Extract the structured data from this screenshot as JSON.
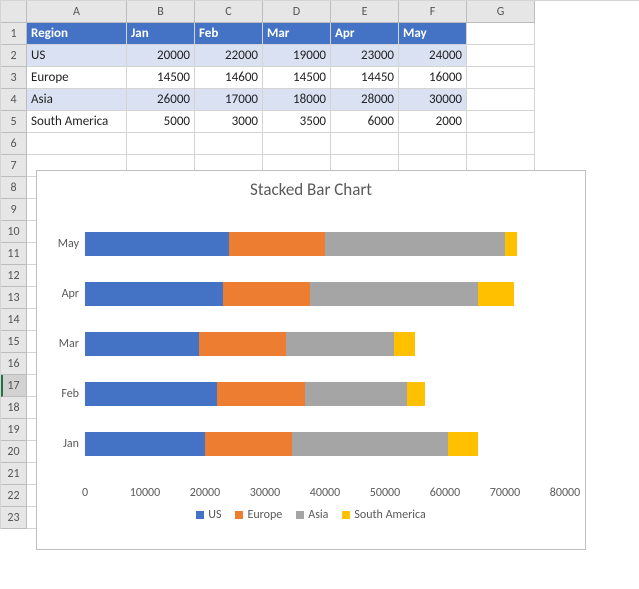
{
  "columns": [
    "A",
    "B",
    "C",
    "D",
    "E",
    "F",
    "G"
  ],
  "row_count": 23,
  "selected_row": 17,
  "table": {
    "headers": [
      "Region",
      "Jan",
      "Feb",
      "Mar",
      "Apr",
      "May"
    ],
    "rows": [
      {
        "region": "US",
        "vals": [
          20000,
          22000,
          19000,
          23000,
          24000
        ]
      },
      {
        "region": "Europe",
        "vals": [
          14500,
          14600,
          14500,
          14450,
          16000
        ]
      },
      {
        "region": "Asia",
        "vals": [
          26000,
          17000,
          18000,
          28000,
          30000
        ]
      },
      {
        "region": "South America",
        "vals": [
          5000,
          3000,
          3500,
          6000,
          2000
        ]
      }
    ]
  },
  "chart_data": {
    "type": "bar",
    "orientation": "horizontal",
    "stacked": true,
    "title": "Stacked Bar Chart",
    "categories": [
      "May",
      "Apr",
      "Mar",
      "Feb",
      "Jan"
    ],
    "series": [
      {
        "name": "US",
        "values": [
          24000,
          23000,
          19000,
          22000,
          20000
        ],
        "color": "#4472C4"
      },
      {
        "name": "Europe",
        "values": [
          16000,
          14450,
          14500,
          14600,
          14500
        ],
        "color": "#ED7D31"
      },
      {
        "name": "Asia",
        "values": [
          30000,
          28000,
          18000,
          17000,
          26000
        ],
        "color": "#A5A5A5"
      },
      {
        "name": "South America",
        "values": [
          2000,
          6000,
          3500,
          3000,
          5000
        ],
        "color": "#FFC000"
      }
    ],
    "xlabel": "",
    "ylabel": "",
    "xlim": [
      0,
      80000
    ],
    "xticks": [
      0,
      10000,
      20000,
      30000,
      40000,
      50000,
      60000,
      70000,
      80000
    ],
    "legend_position": "bottom"
  }
}
